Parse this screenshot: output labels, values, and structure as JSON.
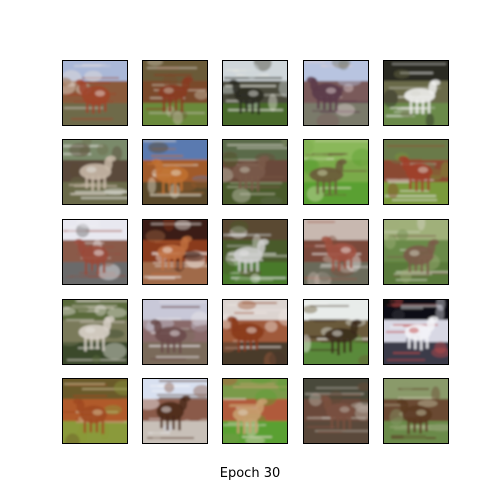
{
  "caption": "Epoch 30",
  "grid": {
    "rows": 5,
    "cols": 5
  },
  "colors": {
    "background": "#ffffff",
    "tile_border": "#000000",
    "caption_text": "#000000"
  },
  "samples": [
    {
      "subject": "horse",
      "sky": "#aab8d8",
      "mid": "#8a5a3a",
      "ground": "#6e6a4a",
      "fg": "#a0442a",
      "accent": "#e8e0dc"
    },
    {
      "subject": "horse",
      "sky": "#6a5a38",
      "mid": "#7a4a2a",
      "ground": "#6a8a3a",
      "fg": "#8a3a22",
      "accent": "#c8c0b0"
    },
    {
      "subject": "horse",
      "sky": "#cfd6da",
      "mid": "#4a4a3a",
      "ground": "#4a6a2a",
      "fg": "#2a2a22",
      "accent": "#e8e8e0"
    },
    {
      "subject": "horse",
      "sky": "#b8c4e0",
      "mid": "#7a5a5a",
      "ground": "#7a7a6a",
      "fg": "#5a3a4a",
      "accent": "#e0d0d0"
    },
    {
      "subject": "horse",
      "sky": "#2a2a22",
      "mid": "#6a6a4a",
      "ground": "#6a8a4a",
      "fg": "#f0f0ee",
      "accent": "#d8d8d0"
    },
    {
      "subject": "horse",
      "sky": "#7a8a6a",
      "mid": "#5a4a3a",
      "ground": "#6a6a4a",
      "fg": "#c8b8a8",
      "accent": "#e8e8e4"
    },
    {
      "subject": "horse",
      "sky": "#5a7ab0",
      "mid": "#a05a2a",
      "ground": "#5a4a2a",
      "fg": "#c07030",
      "accent": "#e8e0d0"
    },
    {
      "subject": "horse",
      "sky": "#5a6a4a",
      "mid": "#6a4a3a",
      "ground": "#4a5a2a",
      "fg": "#7a5a4a",
      "accent": "#c8c8b8"
    },
    {
      "subject": "horse",
      "sky": "#8ab85a",
      "mid": "#7aaa4a",
      "ground": "#5aa030",
      "fg": "#6a5a3a",
      "accent": "#d0d8b0"
    },
    {
      "subject": "horse",
      "sky": "#6a7a4a",
      "mid": "#8a4a32",
      "ground": "#7a9a3a",
      "fg": "#a0402a",
      "accent": "#e0e0d8"
    },
    {
      "subject": "horse",
      "sky": "#e8e8f0",
      "mid": "#8a5a4a",
      "ground": "#6a6a6a",
      "fg": "#9a4a3a",
      "accent": "#f0f0f4"
    },
    {
      "subject": "horse",
      "sky": "#3a1a12",
      "mid": "#8a3a1a",
      "ground": "#a06a4a",
      "fg": "#c07040",
      "accent": "#f4f0ee"
    },
    {
      "subject": "horse",
      "sky": "#5a4a32",
      "mid": "#4a5a2a",
      "ground": "#4a7a2a",
      "fg": "#d0d0d0",
      "accent": "#e8e8e8"
    },
    {
      "subject": "horse",
      "sky": "#c8b8b0",
      "mid": "#7a4a3a",
      "ground": "#6a6a5a",
      "fg": "#a05040",
      "accent": "#f0ecea"
    },
    {
      "subject": "horse",
      "sky": "#a0b07a",
      "mid": "#6a8a4a",
      "ground": "#5a7a3a",
      "fg": "#7a5a4a",
      "accent": "#d8d8c8"
    },
    {
      "subject": "horse",
      "sky": "#5a6a3a",
      "mid": "#7a7a5a",
      "ground": "#3a4a2a",
      "fg": "#d8d0c8",
      "accent": "#e8e4e0"
    },
    {
      "subject": "horse",
      "sky": "#c8c8d8",
      "mid": "#8a6a6a",
      "ground": "#7a6a5a",
      "fg": "#6a4a4a",
      "accent": "#ece8ea"
    },
    {
      "subject": "horse",
      "sky": "#dcd4d0",
      "mid": "#a05a3a",
      "ground": "#4a3a2a",
      "fg": "#8a3a1a",
      "accent": "#f0e8e4"
    },
    {
      "subject": "horse",
      "sky": "#e8ecea",
      "mid": "#6a5a3a",
      "ground": "#5a8a3a",
      "fg": "#3a2a1a",
      "accent": "#f4f4f2"
    },
    {
      "subject": "horse",
      "sky": "#0e0e12",
      "mid": "#d8d8e4",
      "ground": "#3a3a4a",
      "fg": "#f4f4f8",
      "accent": "#c04a4a"
    },
    {
      "subject": "horse",
      "sky": "#6a5a2a",
      "mid": "#b05a2a",
      "ground": "#8a9a3a",
      "fg": "#a04a22",
      "accent": "#d8c8a0"
    },
    {
      "subject": "horse",
      "sky": "#d8e0f0",
      "mid": "#8a5a4a",
      "ground": "#c8c0b8",
      "fg": "#4a2a1a",
      "accent": "#f4f4f8"
    },
    {
      "subject": "horse",
      "sky": "#7a9a4a",
      "mid": "#b05a3a",
      "ground": "#5aa032",
      "fg": "#c8a070",
      "accent": "#e0d8c8"
    },
    {
      "subject": "horse",
      "sky": "#4a4a3a",
      "mid": "#6a4a3a",
      "ground": "#5a4a3a",
      "fg": "#7a5040",
      "accent": "#c0b8b0"
    },
    {
      "subject": "horse",
      "sky": "#8a9a6a",
      "mid": "#6a4a32",
      "ground": "#6a8a4a",
      "fg": "#5a3a22",
      "accent": "#c8c8a8"
    }
  ]
}
